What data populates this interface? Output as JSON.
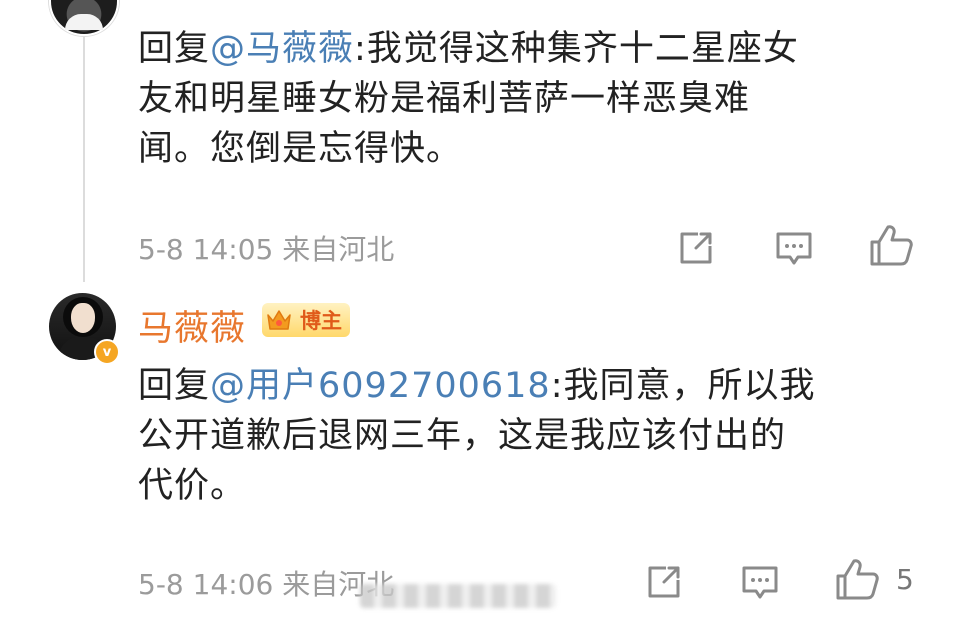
{
  "comment1": {
    "reply_prefix": "回复",
    "mention": "@马薇薇",
    "text_line1_rest": ":我觉得这种集齐十二星座女",
    "text_line2": "友和明星睡女粉是福利菩萨一样恶臭难",
    "text_line3": "闻。您倒是忘得快。",
    "meta": "5-8 14:05  来自河北",
    "icons": [
      "share-icon",
      "comment-icon",
      "like-icon"
    ]
  },
  "comment2": {
    "username": "马薇薇",
    "badge_label": "博主",
    "verified_mark": "v",
    "reply_prefix": "回复",
    "mention": "@用户6092700618",
    "text_line1_rest": ":我同意，所以我",
    "text_line2": "公开道歉后退网三年，这是我应该付出的",
    "text_line3": "代价。",
    "meta": "5-8 14:06  来自河北",
    "like_count": "5",
    "icons": [
      "share-icon",
      "comment-icon",
      "like-icon"
    ]
  },
  "colors": {
    "mention": "#4a7fb5",
    "username": "#e8772e",
    "meta": "#9b9b9b",
    "text": "#222222"
  }
}
